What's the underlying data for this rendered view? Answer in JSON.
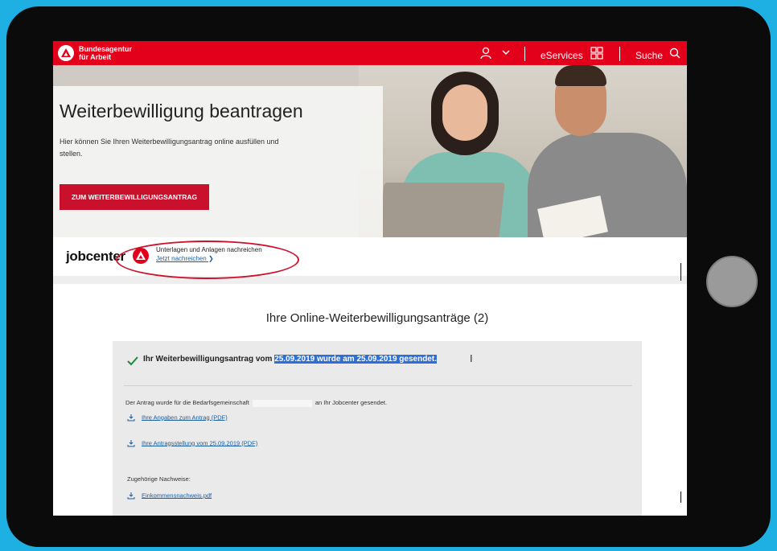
{
  "header": {
    "brand_line1": "Bundesagentur",
    "brand_line2": "für Arbeit",
    "eservices_label": "eServices",
    "search_label": "Suche"
  },
  "hero": {
    "title": "Weiterbewilligung beantragen",
    "description": "Hier können Sie Ihren Weiterbewilligungsantrag online ausfüllen und stellen.",
    "cta_label": "ZUM WEITERBEWILLIGUNGSANTRAG"
  },
  "jobcenter": {
    "logo_text": "jobcenter",
    "upload_title": "Unterlagen und Anlagen nachreichen",
    "upload_link": "Jetzt nachreichen"
  },
  "applications": {
    "title": "Ihre Online-Weiterbewilligungsanträge (2)",
    "status_prefix": "Ihr Weiterbewilligungsantrag vom",
    "status_highlight": "25.09.2019 wurde am 25.09.2019 gesendet.",
    "info_before": "Der Antrag wurde für die Bedarfsgemeinschaft",
    "info_after": "an Ihr Jobcenter gesendet.",
    "downloads": [
      {
        "label": "Ihre Angaben zum Antrag (PDF)"
      },
      {
        "label": "Ihre Antragsstellung vom 25.09.2019 (PDF)"
      }
    ],
    "nachweise_label": "Zugehörige Nachweise:",
    "nachweise_file": "Einkommensnachweis.pdf"
  },
  "colors": {
    "brand_red": "#e2001a",
    "cta_red": "#c9102c",
    "link_blue": "#1a5fa6",
    "selection_blue": "#2f6ed3",
    "tablet_frame": "#0b0b0b",
    "background": "#1fb0e3"
  },
  "icons": [
    "ba-logo-icon",
    "user-icon",
    "chevron-down-icon",
    "grid-icon",
    "search-icon",
    "check-icon",
    "download-icon"
  ]
}
